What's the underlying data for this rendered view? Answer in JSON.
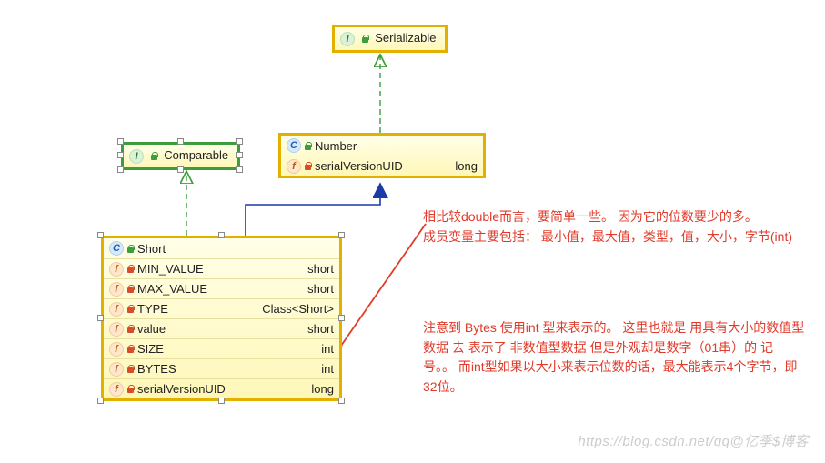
{
  "nodes": {
    "serializable": {
      "kind": "I",
      "color": "#e2b100",
      "name": "Serializable"
    },
    "comparable": {
      "kind": "I",
      "color": "#3a9e3a",
      "name": "Comparable"
    },
    "number": {
      "kind": "C",
      "color": "#e2b100",
      "name": "Number",
      "members": [
        {
          "icon": "f",
          "lock": "red",
          "name": "serialVersionUID",
          "type": "long"
        }
      ]
    },
    "short": {
      "kind": "C",
      "color": "#e2b100",
      "name": "Short",
      "members": [
        {
          "icon": "f",
          "lock": "red",
          "name": "MIN_VALUE",
          "type": "short"
        },
        {
          "icon": "f",
          "lock": "red",
          "name": "MAX_VALUE",
          "type": "short"
        },
        {
          "icon": "f",
          "lock": "red",
          "name": "TYPE",
          "type": "Class<Short>"
        },
        {
          "icon": "f",
          "lock": "red",
          "name": "value",
          "type": "short"
        },
        {
          "icon": "f",
          "lock": "red",
          "name": "SIZE",
          "type": "int"
        },
        {
          "icon": "f",
          "lock": "red",
          "name": "BYTES",
          "type": "int"
        },
        {
          "icon": "f",
          "lock": "red",
          "name": "serialVersionUID",
          "type": "long"
        }
      ]
    }
  },
  "annotations": {
    "p1": "相比较double而言，要简单一些。   因为它的位数要少的多。",
    "p2": "   成员变量主要包括：  最小值，最大值，类型，值，大小，字节(int)",
    "p3": "注意到 Bytes 使用int 型来表示的。   这里也就是 用具有大小的数值型数据   去   表示了 非数值型数据   但是外观却是数字（01串）的 记号。。 而int型如果以大小来表示位数的话，最大能表示4个字节，即32位。"
  },
  "watermark": "https://blog.csdn.net/qq@亿季$博客"
}
